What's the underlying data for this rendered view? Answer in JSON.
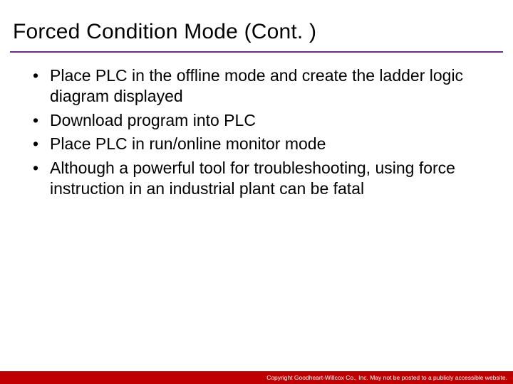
{
  "title": "Forced Condition Mode (Cont. )",
  "bullets": [
    "Place PLC in the offline mode and create the ladder logic diagram displayed",
    "Download program into PLC",
    "Place PLC in run/online monitor mode",
    "Although a powerful tool for troubleshooting, using force instruction in an industrial plant can be fatal"
  ],
  "footer": "Copyright Goodheart-Willcox Co., Inc.  May not be posted to a publicly accessible website.",
  "colors": {
    "underline": "#6b2d8a",
    "footer_bg": "#c00000"
  }
}
